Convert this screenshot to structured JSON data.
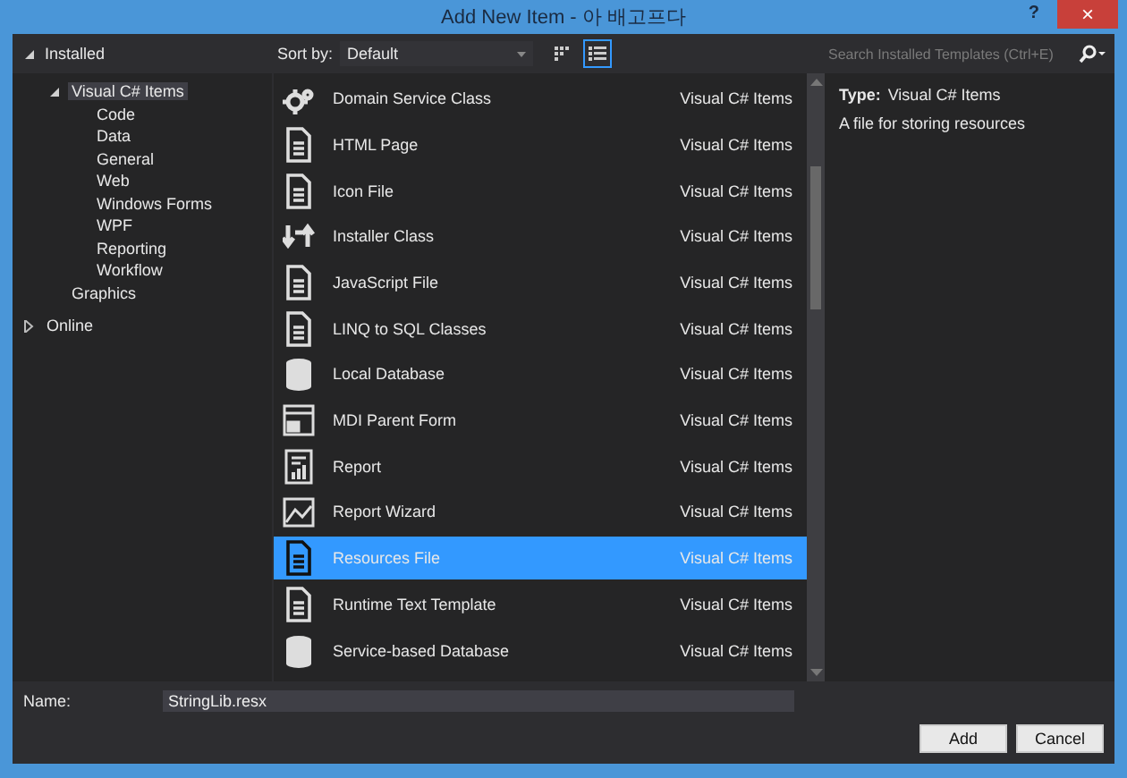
{
  "window": {
    "title": "Add New Item - 아 배고프다",
    "help": "?",
    "close": "×"
  },
  "tree": {
    "items": [
      {
        "label": "Installed",
        "expanded": true,
        "selected": false,
        "children": [
          {
            "label": "Visual C# Items",
            "expanded": true,
            "selected": true,
            "children": [
              {
                "label": "Code",
                "selected": false
              },
              {
                "label": "Data",
                "selected": false
              },
              {
                "label": "General",
                "selected": false
              },
              {
                "label": "Web",
                "selected": false
              },
              {
                "label": "Windows Forms",
                "selected": false
              },
              {
                "label": "WPF",
                "selected": false
              },
              {
                "label": "Reporting",
                "selected": false
              },
              {
                "label": "Workflow",
                "selected": false
              }
            ]
          },
          {
            "label": "Graphics",
            "selected": false
          }
        ]
      },
      {
        "label": "Online",
        "expanded": false,
        "selected": false
      }
    ]
  },
  "sort": {
    "label": "Sort by:",
    "value": "Default",
    "views": [
      {
        "kind": "grid",
        "selected": false
      },
      {
        "kind": "list",
        "selected": true
      }
    ]
  },
  "search": {
    "placeholder": "Search Installed Templates (Ctrl+E)"
  },
  "templates": [
    {
      "name": "Domain Service Class",
      "category": "Visual C# Items",
      "kind": "gear",
      "selected": false
    },
    {
      "name": "HTML Page",
      "category": "Visual C# Items",
      "kind": "page",
      "selected": false
    },
    {
      "name": "Icon File",
      "category": "Visual C# Items",
      "kind": "document",
      "selected": false
    },
    {
      "name": "Installer Class",
      "category": "Visual C# Items",
      "kind": "arrows",
      "selected": false
    },
    {
      "name": "JavaScript File",
      "category": "Visual C# Items",
      "kind": "page",
      "selected": false
    },
    {
      "name": "LINQ to SQL Classes",
      "category": "Visual C# Items",
      "kind": "document",
      "selected": false
    },
    {
      "name": "Local Database",
      "category": "Visual C# Items",
      "kind": "database",
      "selected": false
    },
    {
      "name": "MDI Parent Form",
      "category": "Visual C# Items",
      "kind": "window",
      "selected": false
    },
    {
      "name": "Report",
      "category": "Visual C# Items",
      "kind": "chart",
      "selected": false
    },
    {
      "name": "Report Wizard",
      "category": "Visual C# Items",
      "kind": "image",
      "selected": false
    },
    {
      "name": "Resources File",
      "category": "Visual C# Items",
      "kind": "page",
      "selected": true
    },
    {
      "name": "Runtime Text Template",
      "category": "Visual C# Items",
      "kind": "document",
      "selected": false
    },
    {
      "name": "Service-based Database",
      "category": "Visual C# Items",
      "kind": "database",
      "selected": false
    }
  ],
  "details": {
    "type_label": "Type:",
    "type_value": "Visual C# Items",
    "description": "A file for storing resources"
  },
  "name_field": {
    "label": "Name:",
    "value": "StringLib.resx"
  },
  "buttons": [
    "Add",
    "Cancel"
  ]
}
